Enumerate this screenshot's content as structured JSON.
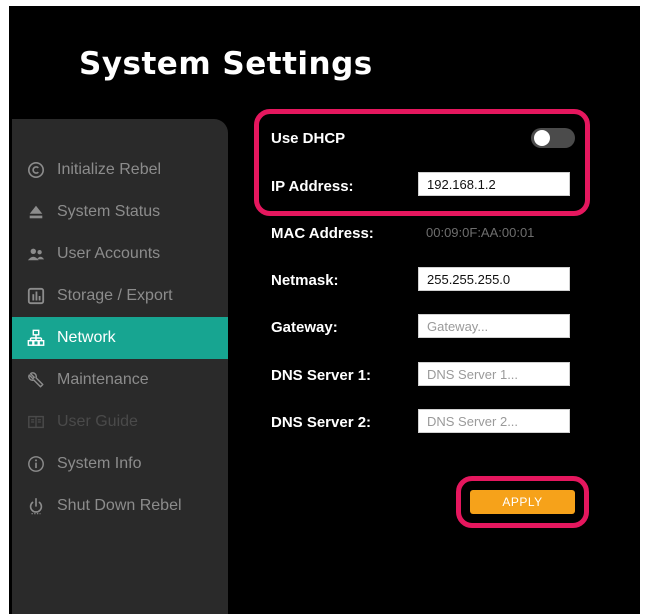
{
  "page_title": "System Settings",
  "sidebar": {
    "items": [
      {
        "label": "Initialize Rebel",
        "icon": "copyright-icon",
        "state": "normal"
      },
      {
        "label": "System Status",
        "icon": "eject-icon",
        "state": "normal"
      },
      {
        "label": "User Accounts",
        "icon": "users-icon",
        "state": "normal"
      },
      {
        "label": "Storage / Export",
        "icon": "chart-box-icon",
        "state": "normal"
      },
      {
        "label": "Network",
        "icon": "network-icon",
        "state": "active"
      },
      {
        "label": "Maintenance",
        "icon": "wrench-icon",
        "state": "normal"
      },
      {
        "label": "User Guide",
        "icon": "book-icon",
        "state": "disabled"
      },
      {
        "label": "System Info",
        "icon": "info-icon",
        "state": "normal"
      },
      {
        "label": "Shut Down Rebel",
        "icon": "power-icon",
        "state": "normal"
      }
    ]
  },
  "form": {
    "use_dhcp": {
      "label": "Use DHCP",
      "enabled": false
    },
    "ip_address": {
      "label": "IP Address:",
      "value": "192.168.1.2"
    },
    "mac_address": {
      "label": "MAC Address:",
      "value": "00:09:0F:AA:00:01"
    },
    "netmask": {
      "label": "Netmask:",
      "value": "255.255.255.0"
    },
    "gateway": {
      "label": "Gateway:",
      "value": "",
      "placeholder": "Gateway..."
    },
    "dns1": {
      "label": "DNS Server 1:",
      "value": "",
      "placeholder": "DNS Server 1..."
    },
    "dns2": {
      "label": "DNS Server 2:",
      "value": "",
      "placeholder": "DNS Server 2..."
    },
    "apply_label": "APPLY"
  },
  "colors": {
    "accent": "#17a591",
    "highlight": "#e5175e",
    "apply": "#f6a21a",
    "background": "#000000",
    "sidebar": "#2a2a2a"
  }
}
